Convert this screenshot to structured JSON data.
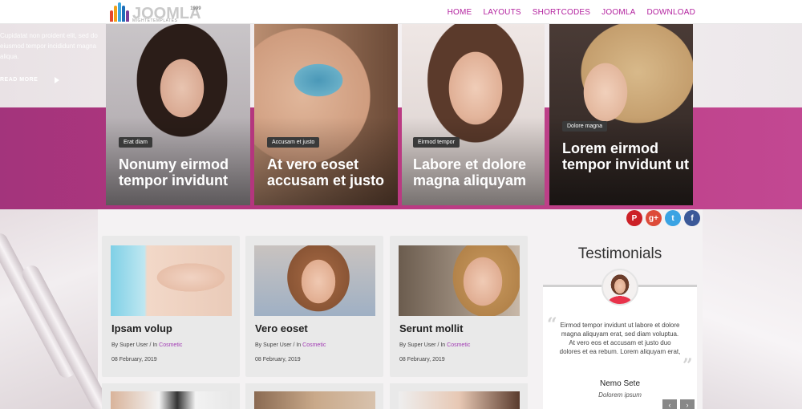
{
  "header": {
    "logo_text": "JOOMLA",
    "logo_year": "1999",
    "logo_sub": "MIGHTETEMPLATES",
    "nav": [
      "HOME",
      "LAYOUTS",
      "SHORTCODES",
      "JOOMLA",
      "DOWNLOAD"
    ]
  },
  "hero": {
    "left_text": "Cupidatat non proident elit, sed do eiusmod tempor incididunt magna aliqua.",
    "read_more": "READ MORE",
    "cards": [
      {
        "tag": "Erat diam",
        "title": "Nonumy eirmod tempor invidunt"
      },
      {
        "tag": "Accusam et justo",
        "title": "At vero eoset accusam et justo"
      },
      {
        "tag": "Eirmod tempor",
        "title": "Labore et dolore magna aliquyam"
      },
      {
        "tag": "Dolore magna",
        "title": "Lorem eirmod tempor invidunt ut"
      }
    ]
  },
  "social": [
    "P",
    "g+",
    "t",
    "f"
  ],
  "articles": [
    {
      "title": "Ipsam volup",
      "author": "By Super User / In ",
      "category": "Cosmetic",
      "date": "08 February, 2019"
    },
    {
      "title": "Vero eoset",
      "author": "By Super User / In ",
      "category": "Cosmetic",
      "date": "08 February, 2019"
    },
    {
      "title": "Serunt mollit",
      "author": "By Super User / In ",
      "category": "Cosmetic",
      "date": "08 February, 2019"
    }
  ],
  "testimonials": {
    "title": "Testimonials",
    "quote": "Eirmod tempor invidunt ut labore et dolore magna aliquyam erat, sed diam voluptua. At vero eos et accusam et justo duo dolores et ea rebum. Lorem aliquyam erat,",
    "name": "Nemo Sete",
    "role": "Dolorem ipsum",
    "prev": "‹",
    "next": "›"
  },
  "colors": {
    "accent": "#b3229f",
    "band": "#b8377f",
    "pinterest": "#cc2127",
    "googleplus": "#dd4b39",
    "twitter": "#3aa3e3",
    "facebook": "#3b5998"
  }
}
